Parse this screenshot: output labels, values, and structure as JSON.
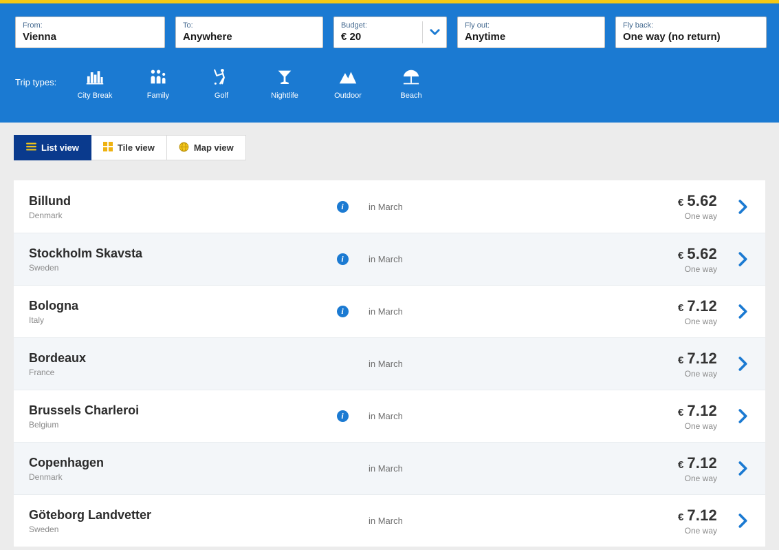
{
  "theme": {
    "header_blue": "#1b7ad2",
    "accent_yellow": "#f5c915",
    "active_tab_navy": "#0a3a8d",
    "price_color": "#333333"
  },
  "glyphs": {
    "info": "i"
  },
  "search_form": {
    "fields": [
      {
        "label": "From:",
        "value": "Vienna"
      },
      {
        "label": "To:",
        "value": "Anywhere"
      },
      {
        "label": "Budget:",
        "value": "€ 20"
      },
      {
        "label": "Fly out:",
        "value": "Anytime"
      },
      {
        "label": "Fly back:",
        "value": "One way (no return)"
      }
    ]
  },
  "trip_types": {
    "label": "Trip types:",
    "items": [
      {
        "label": "City Break"
      },
      {
        "label": "Family"
      },
      {
        "label": "Golf"
      },
      {
        "label": "Nightlife"
      },
      {
        "label": "Outdoor"
      },
      {
        "label": "Beach"
      }
    ]
  },
  "view_tabs": [
    {
      "label": "List view",
      "active": true
    },
    {
      "label": "Tile view",
      "active": false
    },
    {
      "label": "Map view",
      "active": false
    }
  ],
  "results": [
    {
      "city": "Billund",
      "country": "Denmark",
      "has_info": true,
      "when": "in March",
      "currency": "€",
      "price": "5.62",
      "fare_type": "One way"
    },
    {
      "city": "Stockholm Skavsta",
      "country": "Sweden",
      "has_info": true,
      "when": "in March",
      "currency": "€",
      "price": "5.62",
      "fare_type": "One way"
    },
    {
      "city": "Bologna",
      "country": "Italy",
      "has_info": true,
      "when": "in March",
      "currency": "€",
      "price": "7.12",
      "fare_type": "One way"
    },
    {
      "city": "Bordeaux",
      "country": "France",
      "has_info": false,
      "when": "in March",
      "currency": "€",
      "price": "7.12",
      "fare_type": "One way"
    },
    {
      "city": "Brussels Charleroi",
      "country": "Belgium",
      "has_info": true,
      "when": "in March",
      "currency": "€",
      "price": "7.12",
      "fare_type": "One way"
    },
    {
      "city": "Copenhagen",
      "country": "Denmark",
      "has_info": false,
      "when": "in March",
      "currency": "€",
      "price": "7.12",
      "fare_type": "One way"
    },
    {
      "city": "Göteborg Landvetter",
      "country": "Sweden",
      "has_info": false,
      "when": "in March",
      "currency": "€",
      "price": "7.12",
      "fare_type": "One way"
    }
  ]
}
